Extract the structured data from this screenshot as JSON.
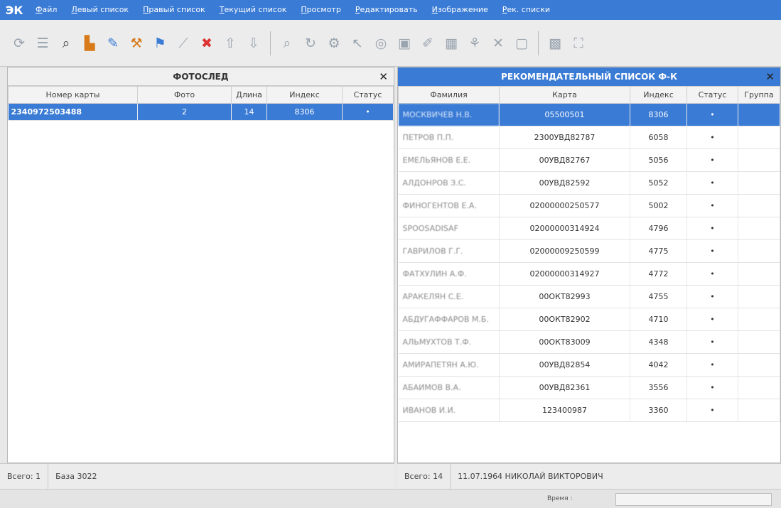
{
  "app": {
    "logo": "ЭК"
  },
  "menu": [
    "Файл",
    "Левый список",
    "Правый список",
    "Текущий список",
    "Просмотр",
    "Редактировать",
    "Изображение",
    "Рек. списки"
  ],
  "toolbar": {
    "buttons": [
      {
        "name": "refresh-icon",
        "glyph": "⟳",
        "tone": "grey"
      },
      {
        "name": "list-icon",
        "glyph": "☰",
        "tone": "grey"
      },
      {
        "name": "binoculars-icon",
        "glyph": "⌕",
        "tone": "active"
      },
      {
        "name": "chart-icon",
        "glyph": "▙",
        "tone": "c-orange"
      },
      {
        "name": "edit-icon",
        "glyph": "✎",
        "tone": "c-blue"
      },
      {
        "name": "hammer-icon",
        "glyph": "⚒",
        "tone": "c-orange"
      },
      {
        "name": "flag-icon",
        "glyph": "⚑",
        "tone": "c-blue"
      },
      {
        "name": "wand-icon",
        "glyph": "⟋",
        "tone": "grey"
      },
      {
        "name": "delete-icon",
        "glyph": "✖",
        "tone": "c-red"
      },
      {
        "name": "arrow-up-icon",
        "glyph": "⇧",
        "tone": "grey"
      },
      {
        "name": "arrow-down-icon",
        "glyph": "⇩",
        "tone": "grey"
      },
      {
        "name": "sep",
        "glyph": "",
        "tone": "sep"
      },
      {
        "name": "zoom-icon",
        "glyph": "⌕",
        "tone": "grey"
      },
      {
        "name": "rotate-icon",
        "glyph": "↻",
        "tone": "grey"
      },
      {
        "name": "settings-icon",
        "glyph": "⚙",
        "tone": "grey"
      },
      {
        "name": "pointer-icon",
        "glyph": "↖",
        "tone": "grey"
      },
      {
        "name": "target-icon",
        "glyph": "◎",
        "tone": "grey"
      },
      {
        "name": "image-icon",
        "glyph": "▣",
        "tone": "grey"
      },
      {
        "name": "brush-icon",
        "glyph": "✐",
        "tone": "grey"
      },
      {
        "name": "grid-icon",
        "glyph": "▦",
        "tone": "grey"
      },
      {
        "name": "tree-icon",
        "glyph": "⚘",
        "tone": "grey"
      },
      {
        "name": "cross-icon",
        "glyph": "✕",
        "tone": "grey"
      },
      {
        "name": "frame-icon",
        "glyph": "▢",
        "tone": "grey"
      },
      {
        "name": "sep",
        "glyph": "",
        "tone": "sep"
      },
      {
        "name": "pattern-icon",
        "glyph": "▩",
        "tone": "grey"
      },
      {
        "name": "expand-icon",
        "glyph": "⛶",
        "tone": "grey"
      }
    ]
  },
  "left_panel": {
    "title": "ФОТОСЛЕД",
    "columns": [
      "Номер карты",
      "Фото",
      "Длина",
      "Индекс",
      "Статус"
    ],
    "rows": [
      {
        "card": "2340972503488",
        "photo": "2",
        "length": "14",
        "index": "8306",
        "status": "•",
        "selected": true
      }
    ],
    "status": {
      "total": "Всего: 1",
      "base": "База 3022"
    }
  },
  "right_panel": {
    "title": "РЕКОМЕНДАТЕЛЬНЫЙ СПИСОК Ф-К",
    "columns": [
      "Фамилия",
      "Карта",
      "Индекс",
      "Статус",
      "Группа"
    ],
    "rows": [
      {
        "name": "МОСКВИЧЕВ Н.В.",
        "card": "05500501",
        "index": "8306",
        "status": "•",
        "group": "",
        "selected": true
      },
      {
        "name": "ПЕТРОВ П.П.",
        "card": "2300УВД82787",
        "index": "6058",
        "status": "•",
        "group": ""
      },
      {
        "name": "ЕМЕЛЬЯНОВ Е.Е.",
        "card": "00УВД82767",
        "index": "5056",
        "status": "•",
        "group": ""
      },
      {
        "name": "АЛДОНРОВ З.С.",
        "card": "00УВД82592",
        "index": "5052",
        "status": "•",
        "group": ""
      },
      {
        "name": "ФИНОГЕНТОВ Е.А.",
        "card": "02000000250577",
        "index": "5002",
        "status": "•",
        "group": ""
      },
      {
        "name": "SPOOSADISAF",
        "card": "02000000314924",
        "index": "4796",
        "status": "•",
        "group": ""
      },
      {
        "name": "ГАВРИЛОВ Г.Г.",
        "card": "02000009250599",
        "index": "4775",
        "status": "•",
        "group": ""
      },
      {
        "name": "ФАТХУЛИН А.Ф.",
        "card": "02000000314927",
        "index": "4772",
        "status": "•",
        "group": ""
      },
      {
        "name": "АРАКЕЛЯН С.Е.",
        "card": "00ОКТ82993",
        "index": "4755",
        "status": "•",
        "group": ""
      },
      {
        "name": "АБДУГАФФАРОВ М.Б.",
        "card": "00ОКТ82902",
        "index": "4710",
        "status": "•",
        "group": ""
      },
      {
        "name": "АЛЬМУХТОВ Т.Ф.",
        "card": "00ОКТ83009",
        "index": "4348",
        "status": "•",
        "group": ""
      },
      {
        "name": "АМИРАПЕТЯН А.Ю.",
        "card": "00УВД82854",
        "index": "4042",
        "status": "•",
        "group": ""
      },
      {
        "name": "АБАИМОВ В.А.",
        "card": "00УВД82361",
        "index": "3556",
        "status": "•",
        "group": ""
      },
      {
        "name": "ИВАНОВ И.И.",
        "card": "123400987",
        "index": "3360",
        "status": "•",
        "group": ""
      }
    ],
    "status": {
      "total": "Всего: 14",
      "info": "11.07.1964 НИКОЛАЙ ВИКТОРОВИЧ"
    }
  },
  "bottom": {
    "time_label": "Время :"
  }
}
